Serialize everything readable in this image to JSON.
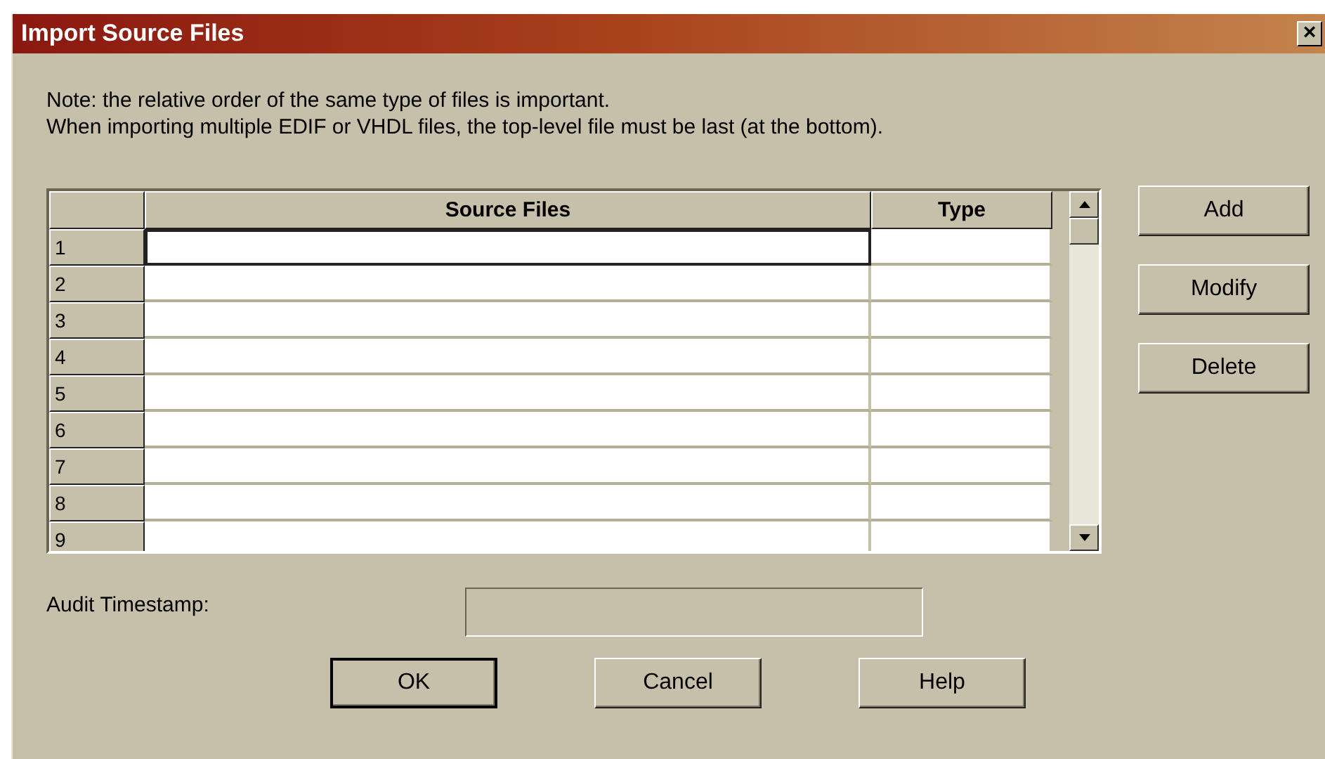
{
  "window": {
    "title": "Import Source Files",
    "close": "×"
  },
  "note": [
    "Note: the relative order of the same type of files is important.",
    "When importing multiple EDIF or VHDL files, the top-level file must be last (at the bottom)."
  ],
  "table": {
    "columns": [
      "Source Files",
      "Type"
    ],
    "rows": [
      {
        "number": "1",
        "selected": true
      },
      {
        "number": "2",
        "selected": false
      },
      {
        "number": "3",
        "selected": false
      },
      {
        "number": "4",
        "selected": false
      },
      {
        "number": "5",
        "selected": false
      },
      {
        "number": "6",
        "selected": false
      },
      {
        "number": "7",
        "selected": false
      },
      {
        "number": "8",
        "selected": false
      },
      {
        "number": "9",
        "selected": false
      }
    ]
  },
  "side_buttons": [
    "Add",
    "Modify",
    "Delete"
  ],
  "audit_timestamp": {
    "label": "Audit Timestamp:"
  },
  "buttons": [
    {
      "label": "OK",
      "default": true
    },
    {
      "label": "Cancel",
      "default": false
    },
    {
      "label": "Help",
      "default": false
    }
  ]
}
